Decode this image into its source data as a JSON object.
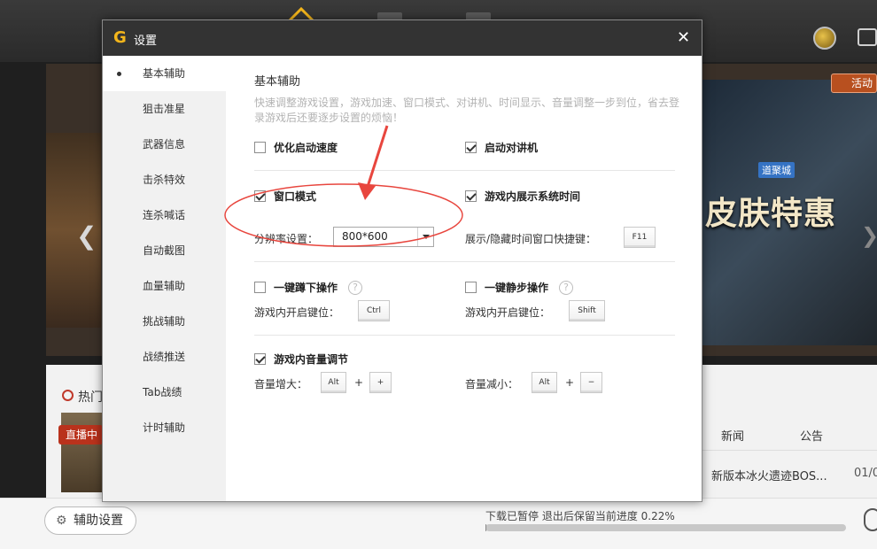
{
  "background": {
    "activity_label": "活动",
    "banner_text": "皮肤特惠",
    "banner_tag": "道聚城",
    "hot_label": "热门",
    "live_badge": "直播中",
    "news_tabs": [
      "新闻",
      "公告"
    ],
    "news_item": "新版本冰火遗迹BOS...",
    "news_date": "01/0",
    "assist_button": "辅助设置",
    "download_status": "下载已暂停 退出后保留当前进度 0.22%",
    "download_progress": 0.22
  },
  "modal": {
    "title": "设置",
    "close": "✕",
    "sidebar": [
      {
        "label": "基本辅助",
        "active": true
      },
      {
        "label": "狙击准星"
      },
      {
        "label": "武器信息"
      },
      {
        "label": "击杀特效"
      },
      {
        "label": "连杀喊话"
      },
      {
        "label": "自动截图"
      },
      {
        "label": "血量辅助"
      },
      {
        "label": "挑战辅助"
      },
      {
        "label": "战绩推送"
      },
      {
        "label": "Tab战绩"
      },
      {
        "label": "计时辅助"
      }
    ],
    "section": {
      "title": "基本辅助",
      "description": "快速调整游戏设置，游戏加速、窗口模式、对讲机、时间显示、音量调整一步到位，省去登录游戏后还要逐步设置的烦恼！"
    },
    "options": {
      "optimize_startup": {
        "label": "优化启动速度",
        "checked": false
      },
      "start_intercom": {
        "label": "启动对讲机",
        "checked": true
      },
      "window_mode": {
        "label": "窗口模式",
        "checked": true
      },
      "resolution_label": "分辨率设置：",
      "resolution_value": "800*600",
      "show_system_time": {
        "label": "游戏内展示系统时间",
        "checked": true
      },
      "time_hotkey_label": "展示/隐藏时间窗口快捷键：",
      "time_hotkey": "F11",
      "one_key_crouch": {
        "label": "一键蹲下操作",
        "checked": false
      },
      "crouch_hotkey_label": "游戏内开启键位：",
      "crouch_hotkey": "Ctrl",
      "one_key_walk": {
        "label": "一键静步操作",
        "checked": false
      },
      "walk_hotkey_label": "游戏内开启键位：",
      "walk_hotkey": "Shift",
      "volume_adjust": {
        "label": "游戏内音量调节",
        "checked": true
      },
      "volume_up_label": "音量增大：",
      "volume_up_keys": [
        "Alt",
        "+"
      ],
      "volume_down_label": "音量减小：",
      "volume_down_keys": [
        "Alt",
        "−"
      ],
      "plus_sign": "+",
      "help_glyph": "?"
    }
  },
  "colors": {
    "annotation_red": "#e8463e",
    "titlebar": "#333333",
    "gold": "#f3b51b"
  }
}
